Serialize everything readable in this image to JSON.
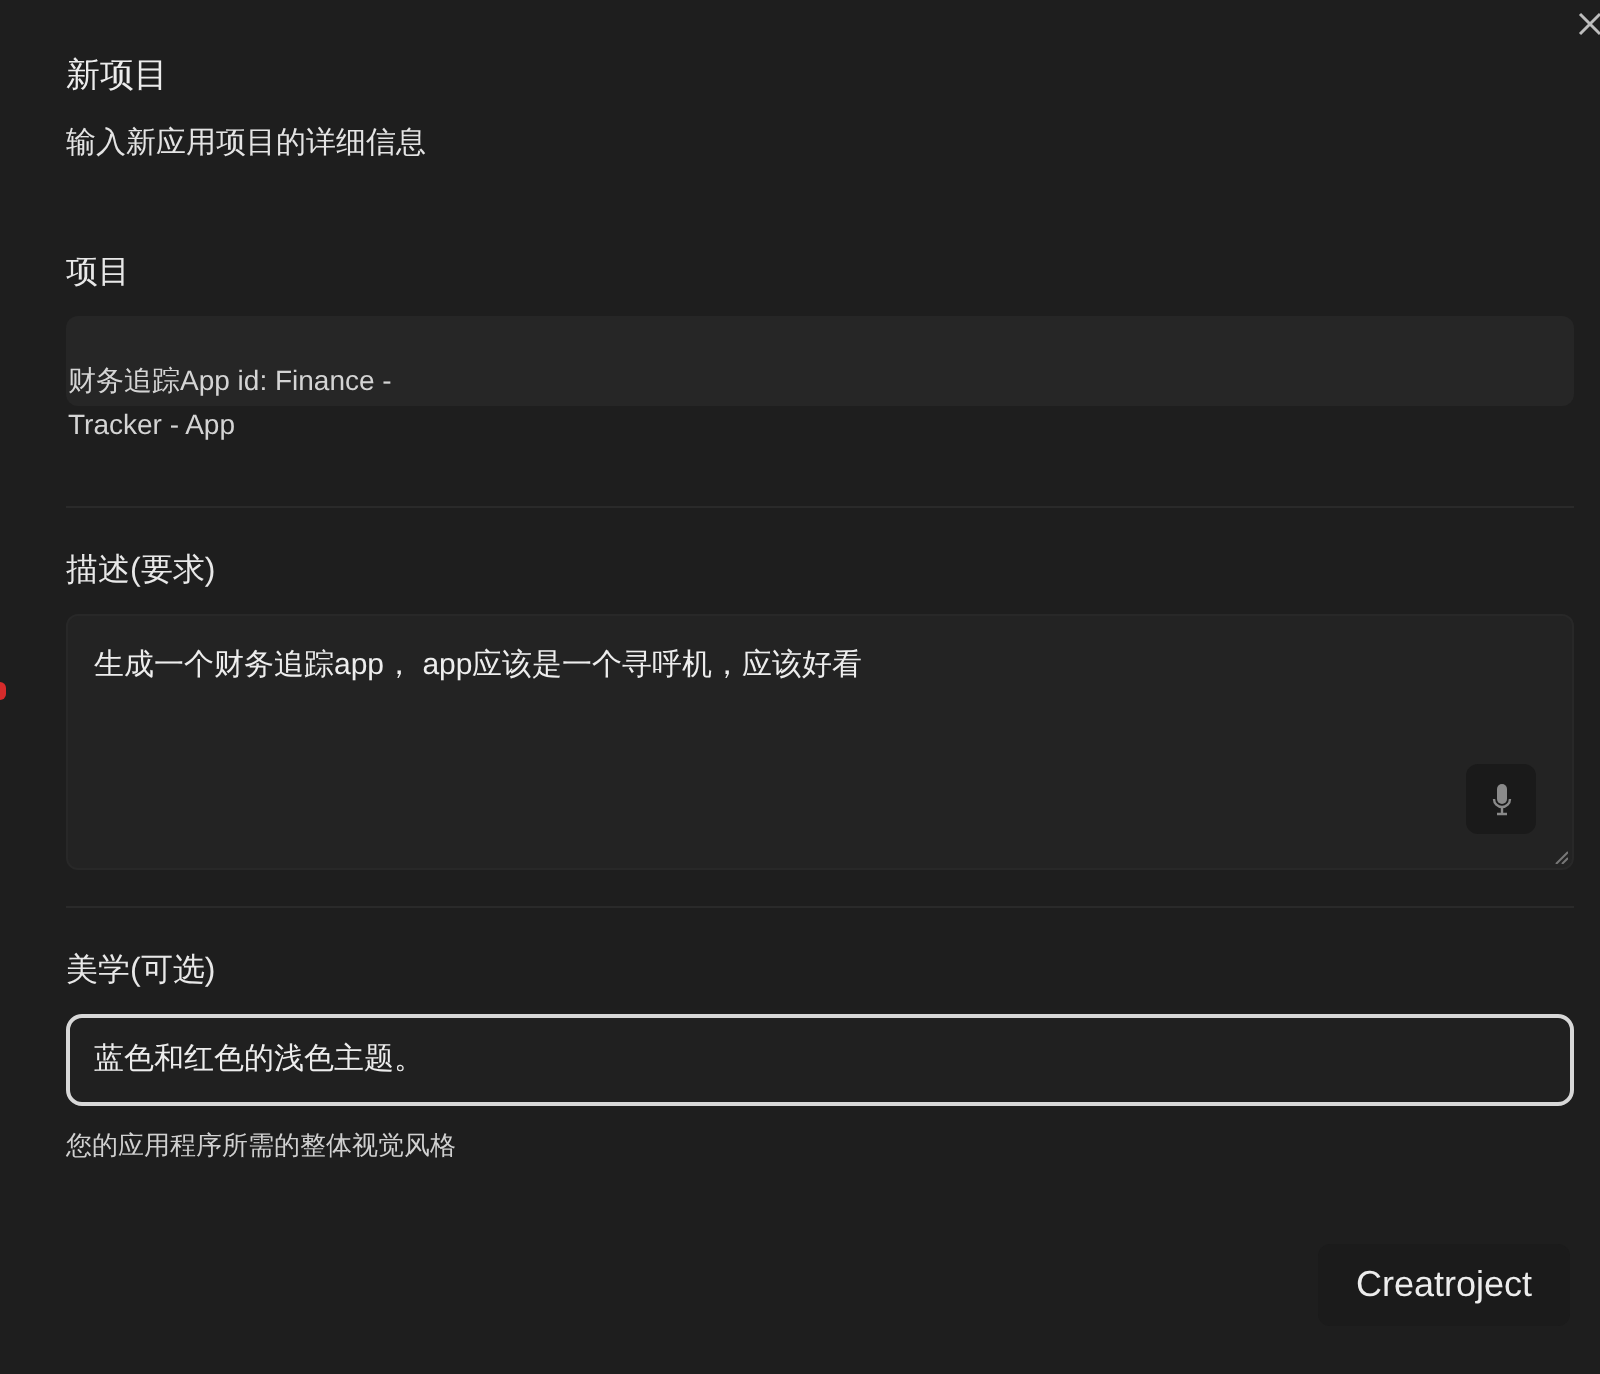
{
  "dialog": {
    "title": "新项目",
    "subtitle": "输入新应用项目的详细信息"
  },
  "fields": [
    {
      "kind": "text",
      "label": "项目",
      "value": "财务追踪App id: Finance - Tracker - App",
      "focused": false
    },
    {
      "kind": "textarea",
      "label": "描述(要求)",
      "value": "生成一个财务追踪app， app应该是一个寻呼机，应该好看",
      "focused": false
    },
    {
      "kind": "input",
      "label": "美学(可选)",
      "value": "蓝色和红色的浅色主题。",
      "focused": true,
      "helper": "您的应用程序所需的整体视觉风格"
    }
  ],
  "primary_button": "Creatroject"
}
